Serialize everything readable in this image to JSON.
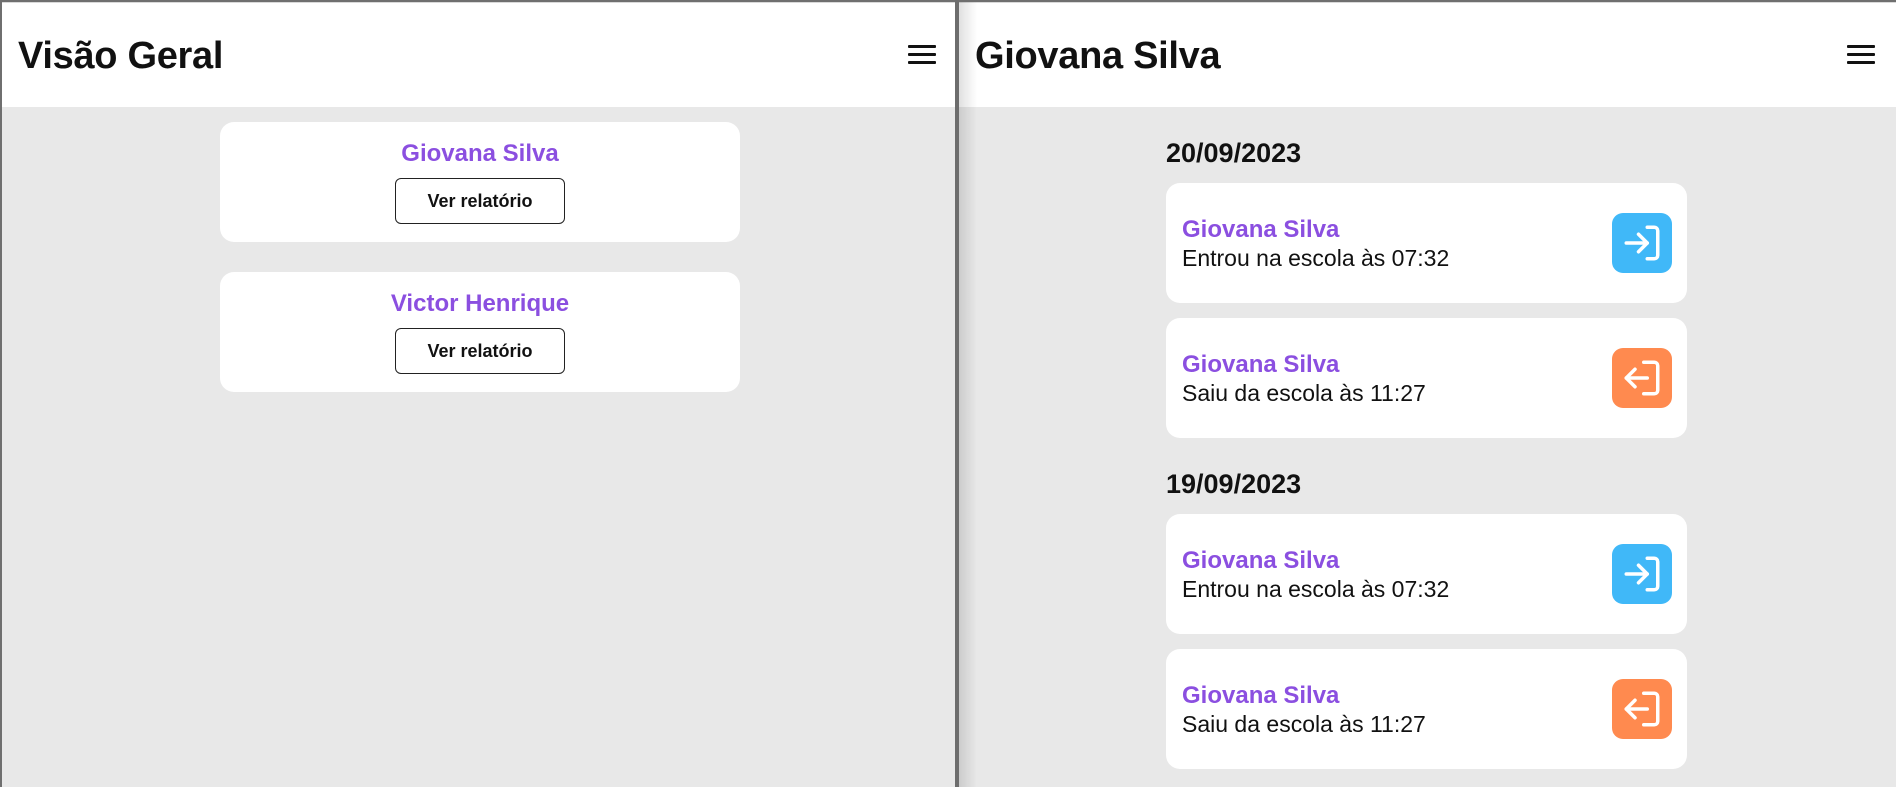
{
  "left_screen": {
    "title": "Visão Geral",
    "menu_icon": "hamburger-menu-icon",
    "students": [
      {
        "name": "Giovana Silva",
        "button_label": "Ver relatório"
      },
      {
        "name": "Victor Henrique",
        "button_label": "Ver relatório"
      }
    ]
  },
  "right_screen": {
    "title": "Giovana Silva",
    "menu_icon": "hamburger-menu-icon",
    "days": [
      {
        "date": "20/09/2023",
        "events": [
          {
            "name": "Giovana Silva",
            "description": "Entrou na escola às 07:32",
            "type": "entry",
            "icon": "login-arrow-icon",
            "color": "#40b8f8"
          },
          {
            "name": "Giovana Silva",
            "description": "Saiu da escola às 11:27",
            "type": "exit",
            "icon": "logout-arrow-icon",
            "color": "#ff8a4f"
          }
        ]
      },
      {
        "date": "19/09/2023",
        "events": [
          {
            "name": "Giovana Silva",
            "description": "Entrou na escola às 07:32",
            "type": "entry",
            "icon": "login-arrow-icon",
            "color": "#40b8f8"
          },
          {
            "name": "Giovana Silva",
            "description": "Saiu da escola às 11:27",
            "type": "exit",
            "icon": "logout-arrow-icon",
            "color": "#ff8a4f"
          }
        ]
      }
    ]
  },
  "colors": {
    "accent_purple": "#8b4fe0",
    "background": "#e8e8e8",
    "entry_blue": "#40b8f8",
    "exit_orange": "#ff8a4f"
  }
}
